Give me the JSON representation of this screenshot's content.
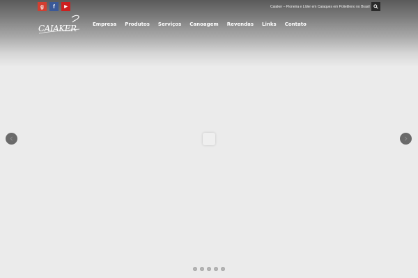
{
  "header": {
    "tagline": "Caiaker – Pioneira e Líder em Caiaques em Polietileno no Brasil",
    "logo": {
      "text": "CAIAKER"
    }
  },
  "social": [
    {
      "name": "google-plus",
      "glyph": "g",
      "color": "#d23f31"
    },
    {
      "name": "facebook",
      "glyph": "f",
      "color": "#3b5998"
    },
    {
      "name": "youtube",
      "glyph": "▶",
      "color": "#cd201f"
    }
  ],
  "nav": {
    "items": [
      {
        "label": "Empresa"
      },
      {
        "label": "Produtos"
      },
      {
        "label": "Serviços"
      },
      {
        "label": "Canoagem"
      },
      {
        "label": "Revendas"
      },
      {
        "label": "Links"
      },
      {
        "label": "Contato"
      }
    ]
  },
  "slider": {
    "slide_count": 5,
    "prev_icon": "chevron-left-icon",
    "next_icon": "chevron-right-icon"
  },
  "search": {
    "icon": "search-icon"
  }
}
